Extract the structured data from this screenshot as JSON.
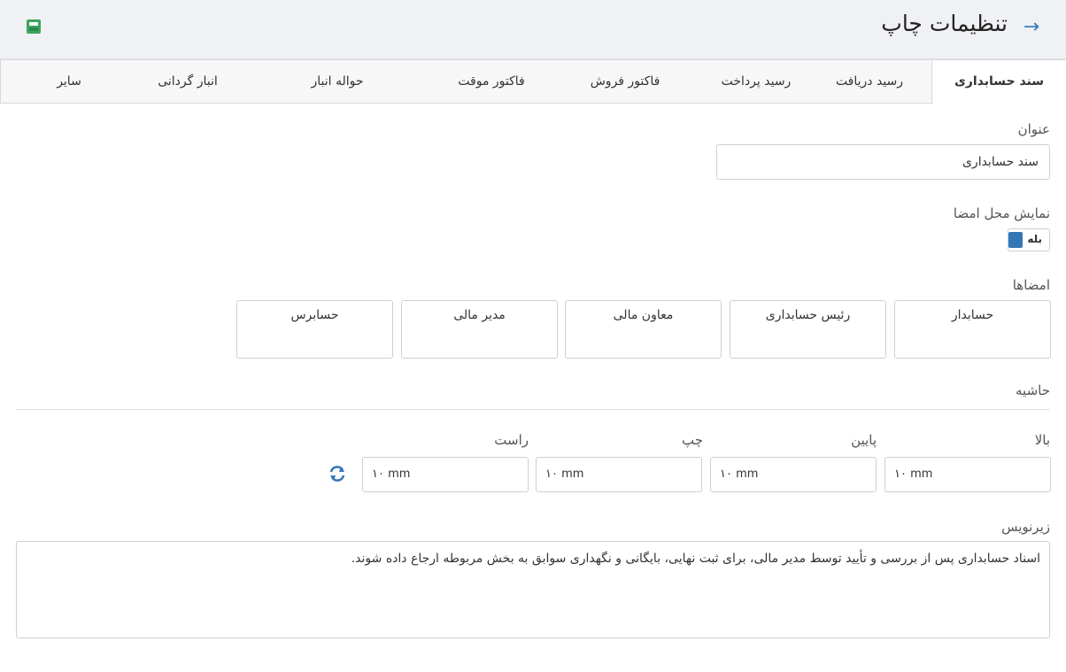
{
  "header": {
    "title": "تنظیمات چاپ",
    "back_icon": "arrow-right-icon",
    "save_icon": "save-icon",
    "save_color": "#3ba55d",
    "accent": "#3477b7"
  },
  "tabs": [
    {
      "label": "سند حسابداری",
      "active": true
    },
    {
      "label": "رسید دریافت",
      "active": false
    },
    {
      "label": "رسید پرداخت",
      "active": false
    },
    {
      "label": "فاکتور فروش",
      "active": false
    },
    {
      "label": "فاکتور موقت",
      "active": false
    },
    {
      "label": "حواله انبار",
      "active": false
    },
    {
      "label": "انبار گردانی",
      "active": false
    },
    {
      "label": "سایر",
      "active": false
    }
  ],
  "form": {
    "title_label": "عنوان",
    "title_value": "سند حسابداری",
    "show_signature_label": "نمایش محل امضا",
    "show_signature_toggle": "بله",
    "show_signature_enabled": true,
    "signatures_label": "امضاها",
    "signatures": [
      "حسابدار",
      "رئیس حسابداری",
      "معاون مالی",
      "مدیر مالی",
      "حسابرس"
    ],
    "margin_label": "حاشیه",
    "margins": [
      {
        "label": "بالا",
        "value": "۱۰ mm"
      },
      {
        "label": "پایین",
        "value": "۱۰ mm"
      },
      {
        "label": "چپ",
        "value": "۱۰ mm"
      },
      {
        "label": "راست",
        "value": "۱۰ mm"
      }
    ],
    "refresh_icon": "refresh-icon",
    "footer_label": "زیرنویس",
    "footer_value": "اسناد حسابداری پس از بررسی و تأیید توسط مدیر مالی، برای ثبت نهایی، بایگانی و نگهداری سوابق به بخش مربوطه ارجاع داده شوند."
  }
}
